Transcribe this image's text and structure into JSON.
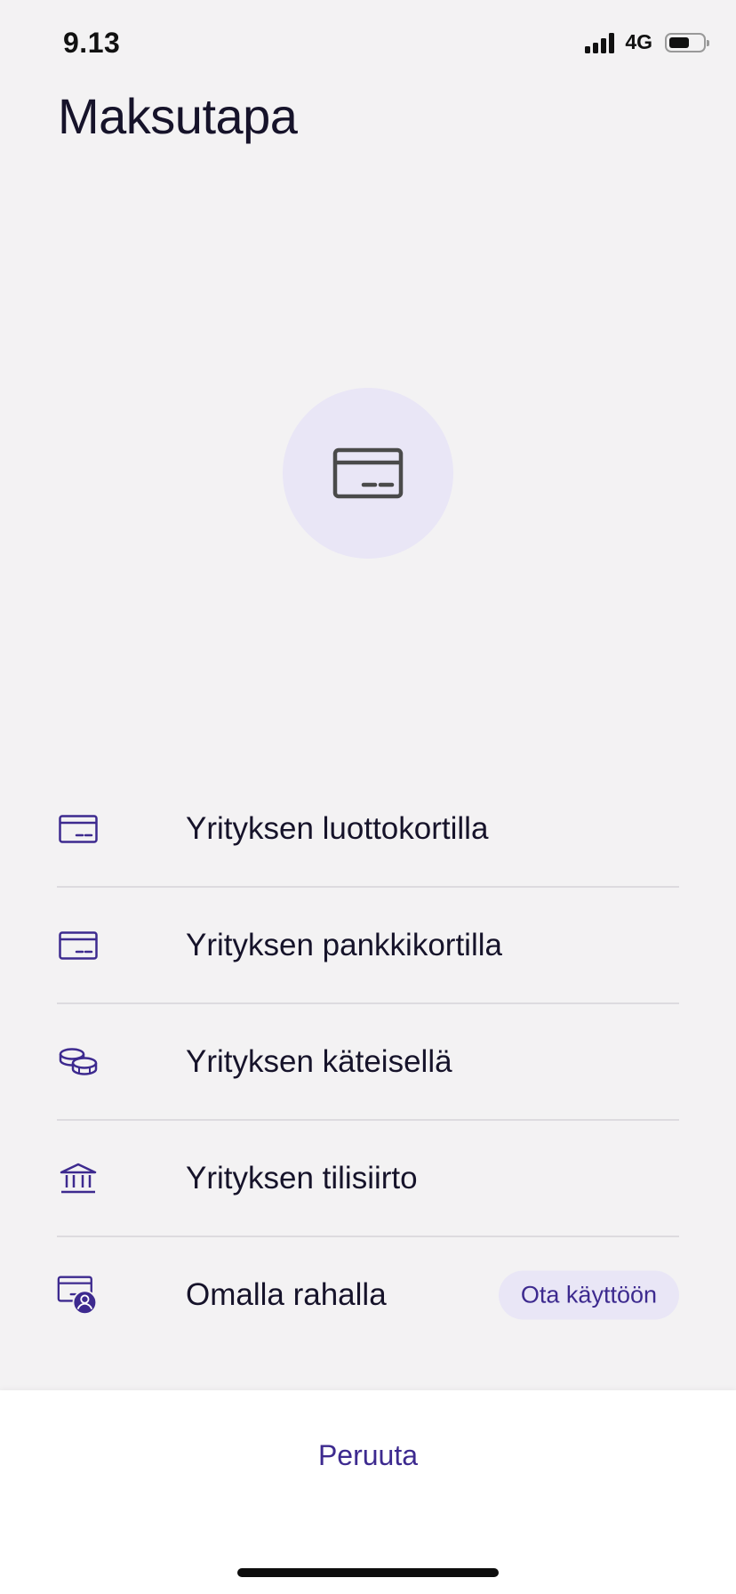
{
  "status_bar": {
    "time": "9.13",
    "network": "4G",
    "battery_level": 0.6
  },
  "header": {
    "title": "Maksutapa"
  },
  "hero": {
    "icon": "credit-card-icon"
  },
  "payment_methods": [
    {
      "label": "Yrityksen luottokortilla",
      "icon": "credit-card-icon"
    },
    {
      "label": "Yrityksen pankkikortilla",
      "icon": "debit-card-icon"
    },
    {
      "label": "Yrityksen käteisellä",
      "icon": "coins-icon"
    },
    {
      "label": "Yrityksen tilisiirto",
      "icon": "bank-icon"
    },
    {
      "label": "Omalla rahalla",
      "icon": "personal-card-icon",
      "action_label": "Ota käyttöön"
    }
  ],
  "footer": {
    "cancel_label": "Peruuta"
  },
  "colors": {
    "background": "#f3f2f3",
    "accent": "#3d2a8f",
    "accent_light": "#e9e6f6",
    "text": "#16132a",
    "divider": "#dddbdf"
  }
}
